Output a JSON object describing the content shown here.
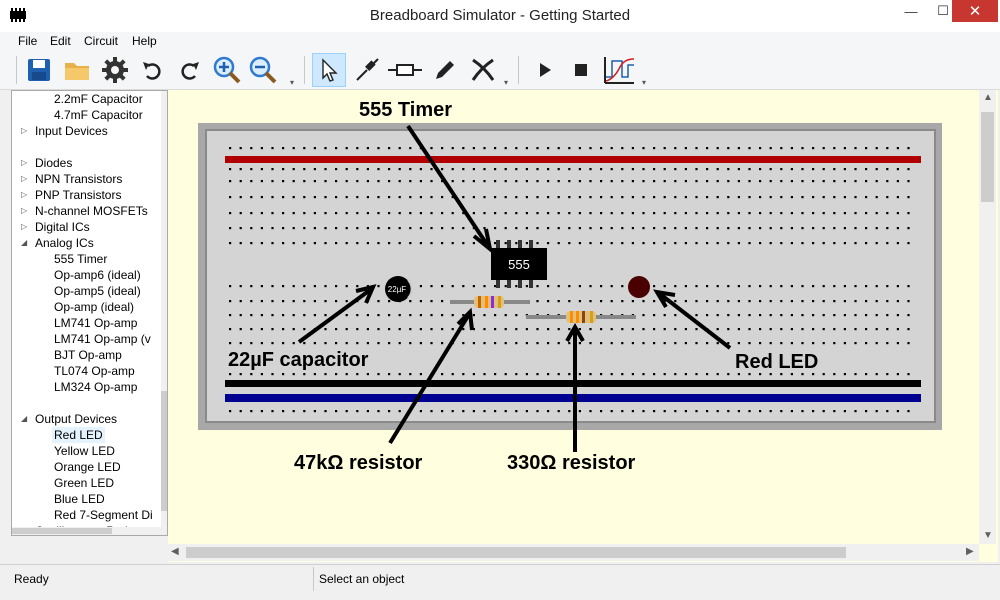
{
  "window": {
    "title": "Breadboard Simulator - Getting Started",
    "minimize": "—",
    "maximize": "☐",
    "close": "✕"
  },
  "menu": [
    "File",
    "Edit",
    "Circuit",
    "Help"
  ],
  "toolbar": {
    "buttons": [
      "save-icon",
      "open-folder-icon",
      "settings-gear-icon",
      "undo-icon",
      "redo-icon",
      "zoom-in-icon",
      "zoom-out-icon",
      "select-pointer-icon",
      "probe-icon",
      "resistor-wire-icon",
      "pencil-icon",
      "cut-wire-icon",
      "play-icon",
      "stop-icon",
      "scope-graph-icon"
    ],
    "selected": "select-pointer-icon"
  },
  "component_tree": [
    {
      "label": "2.2mF Capacitor",
      "level": 2
    },
    {
      "label": "4.7mF Capacitor",
      "level": 2
    },
    {
      "label": "Input Devices",
      "level": 1,
      "expander": "collapsed"
    },
    {
      "label": "",
      "level": 1
    },
    {
      "label": "Diodes",
      "level": 1,
      "expander": "collapsed"
    },
    {
      "label": "NPN Transistors",
      "level": 1,
      "expander": "collapsed"
    },
    {
      "label": "PNP Transistors",
      "level": 1,
      "expander": "collapsed"
    },
    {
      "label": "N-channel MOSFETs",
      "level": 1,
      "expander": "collapsed"
    },
    {
      "label": "Digital ICs",
      "level": 1,
      "expander": "collapsed"
    },
    {
      "label": "Analog ICs",
      "level": 1,
      "expander": "expanded"
    },
    {
      "label": "555 Timer",
      "level": 2
    },
    {
      "label": "Op-amp6 (ideal)",
      "level": 2
    },
    {
      "label": "Op-amp5 (ideal)",
      "level": 2
    },
    {
      "label": "Op-amp (ideal)",
      "level": 2
    },
    {
      "label": "LM741 Op-amp",
      "level": 2
    },
    {
      "label": "LM741 Op-amp (v",
      "level": 2
    },
    {
      "label": "BJT Op-amp",
      "level": 2
    },
    {
      "label": "TL074 Op-amp",
      "level": 2
    },
    {
      "label": "LM324 Op-amp",
      "level": 2
    },
    {
      "label": "",
      "level": 1
    },
    {
      "label": "Output Devices",
      "level": 1,
      "expander": "expanded"
    },
    {
      "label": "Red LED",
      "level": 2,
      "selected": true
    },
    {
      "label": "Yellow LED",
      "level": 2
    },
    {
      "label": "Orange LED",
      "level": 2
    },
    {
      "label": "Green LED",
      "level": 2
    },
    {
      "label": "Blue LED",
      "level": 2
    },
    {
      "label": "Red 7-Segment Di",
      "level": 2
    },
    {
      "label": "Oscilloscope Probe",
      "level": 1
    }
  ],
  "breadboard": {
    "components": {
      "chip_label": "555",
      "capacitor_label": "22µF"
    },
    "colors": {
      "rail_red": "#b00000",
      "rail_black": "#000000",
      "rail_blue": "#000090",
      "board": "#d4d4d4",
      "led": "#4a0000"
    }
  },
  "annotations": {
    "timer": "555 Timer",
    "capacitor": "22µF capacitor",
    "red_led": "Red LED",
    "r47k": "47kΩ resistor",
    "r330": "330Ω resistor"
  },
  "status": {
    "left": "Ready",
    "right": "Select an object"
  }
}
